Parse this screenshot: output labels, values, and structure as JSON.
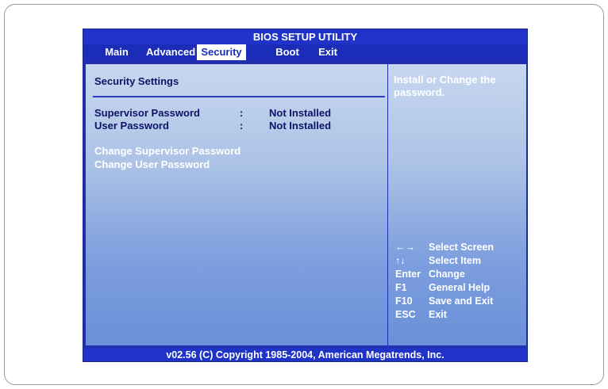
{
  "title": "BIOS SETUP UTILITY",
  "menu": [
    {
      "label": "Main",
      "active": false
    },
    {
      "label": "Advanced",
      "active": false
    },
    {
      "label": "Security",
      "active": true
    },
    {
      "label": "Boot",
      "active": false
    },
    {
      "label": "Exit",
      "active": false
    }
  ],
  "section_title": "Security Settings",
  "settings": [
    {
      "label": "Supervisor Password",
      "colon": ":",
      "value": "Not Installed"
    },
    {
      "label": "User Password",
      "colon": ":",
      "value": "Not Installed"
    }
  ],
  "actions": [
    {
      "label": "Change Supervisor Password"
    },
    {
      "label": "Change User Password"
    }
  ],
  "help_text": "Install or Change the password.",
  "keys": [
    {
      "key": "←→",
      "desc": "Select Screen"
    },
    {
      "key": "↑↓",
      "desc": "Select Item"
    },
    {
      "key": "Enter",
      "desc": "Change"
    },
    {
      "key": "F1",
      "desc": "General Help"
    },
    {
      "key": "F10",
      "desc": "Save and Exit"
    },
    {
      "key": "ESC",
      "desc": "Exit"
    }
  ],
  "footer": "v02.56 (C) Copyright  1985-2004, American Megatrends, Inc.",
  "colors": {
    "bios_blue": "#1f2fb0",
    "panel_light": "#c7d7ef",
    "panel_dark": "#6b8fd9",
    "text_dark": "#0c1466",
    "text_light": "#ffffff"
  }
}
